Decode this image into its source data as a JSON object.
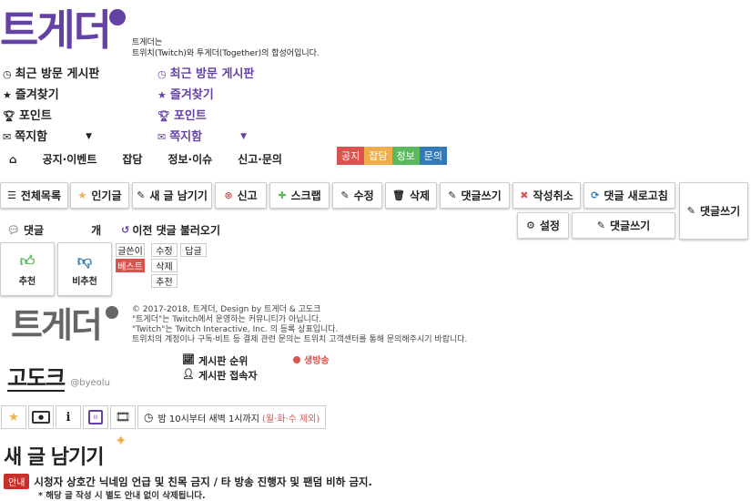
{
  "logo": {
    "text": "트게더"
  },
  "tagline": {
    "line1": "트게더는",
    "line2": "트위치(Twitch)와 투게더(Together)의 합성어입니다."
  },
  "nav_left": [
    {
      "icon": "clock-icon",
      "label": "최근 방문 게시판"
    },
    {
      "icon": "star-icon",
      "label": "즐겨찾기"
    },
    {
      "icon": "trophy-icon",
      "label": "포인트"
    },
    {
      "icon": "envelope-icon",
      "label": "쪽지함"
    }
  ],
  "nav_right": [
    {
      "icon": "clock-icon",
      "label": "최근 방문 게시판"
    },
    {
      "icon": "star-icon",
      "label": "즐겨찾기"
    },
    {
      "icon": "trophy-icon",
      "label": "포인트"
    },
    {
      "icon": "envelope-icon",
      "label": "쪽지함"
    }
  ],
  "menu": {
    "items": [
      "공지·이벤트",
      "잡담",
      "정보·이슈",
      "신고·문의"
    ]
  },
  "tags": [
    {
      "label": "공지",
      "color": "#d9534f"
    },
    {
      "label": "잡담",
      "color": "#f0ad4e"
    },
    {
      "label": "정보",
      "color": "#5cb85c"
    },
    {
      "label": "문의",
      "color": "#337ab7"
    }
  ],
  "toolbar": {
    "list": "전체목록",
    "popular": "인기글",
    "new_post": "새 글 남기기",
    "report": "신고",
    "scrap": "스크랩",
    "edit": "수정",
    "delete": "삭제",
    "comment": "댓글쓰기",
    "cancel": "작성취소",
    "refresh": "댓글 새로고침",
    "settings": "설정",
    "comment2": "댓글쓰기",
    "comment3": "댓글쓰기"
  },
  "comments": {
    "label": "댓글",
    "count_unit": "개",
    "load_prev": "이전 댓글 불러오기"
  },
  "vote": {
    "up": "추천",
    "down": "비추천"
  },
  "small_buttons": {
    "author": "글쓴이",
    "best": "베스트",
    "edit": "수정",
    "reply": "답글",
    "delete": "삭제",
    "recommend": "추천"
  },
  "footer": {
    "line1": "© 2017-2018, 트게더, Design by 트게더 & 고도크",
    "line2": "\"트게더\"는 Twitch에서 운영하는 커뮤니티가 아닙니다.",
    "line3": "\"Twitch\"는 Twitch Interactive, Inc. 의 등록 상표입니다.",
    "line4": "트위치의 계정이나 구독·비트 등 결제 관련 문의는 트위치 고객센터를 통해 문의해주시기 바랍니다."
  },
  "channel": {
    "name": "고도크",
    "handle": "@byeolu",
    "rank": "게시판 순위",
    "visitors": "게시판 접속자",
    "live": "생방송"
  },
  "schedule": {
    "text": "밤 10시부터 새벽 1시까지",
    "except": "(월·화·수 제외)"
  },
  "compose": {
    "title": "새 글 남기기",
    "notice_badge": "안내",
    "notice": "시청자 상호간 닉네임 언급 및 친목 금지 / 타 방송 진행자 및 팬덤 비하 금지.",
    "warning": "* 해당 글 작성 시 별도 안내 없이 삭제됩니다."
  },
  "colors": {
    "accent": "#6441a5",
    "live": "#d9534f",
    "notice": "#c9302c"
  }
}
